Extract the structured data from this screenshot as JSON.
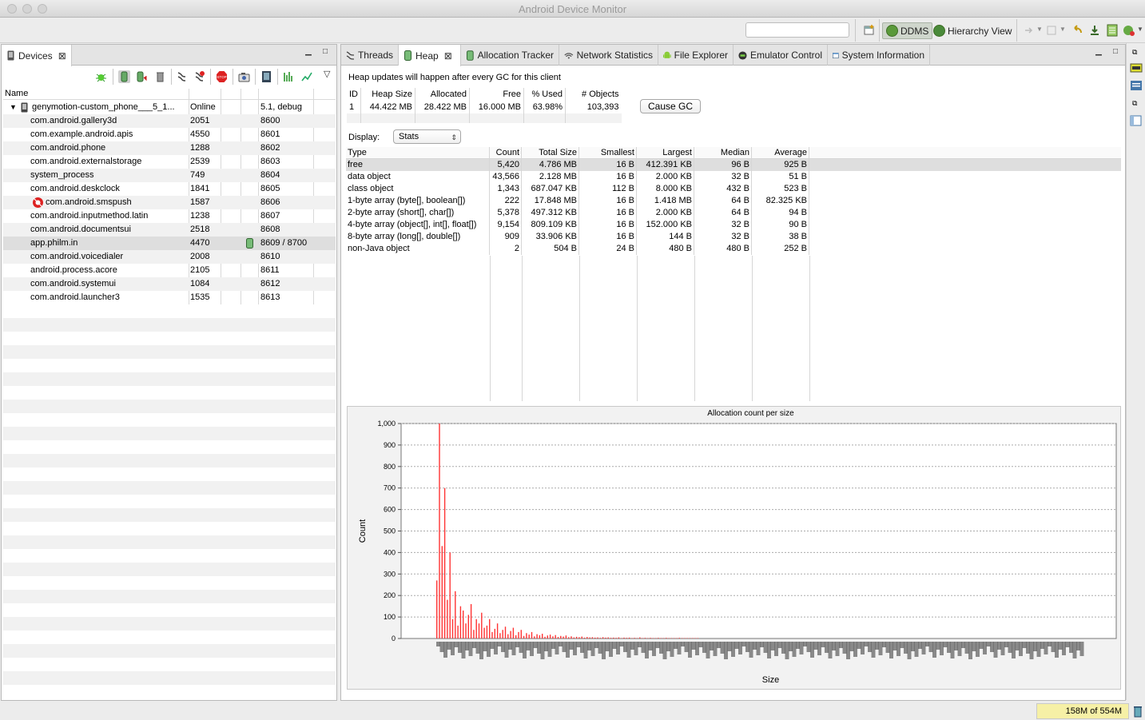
{
  "window": {
    "title": "Android Device Monitor"
  },
  "toolbar": {
    "perspectives": [
      {
        "label": "DDMS",
        "active": true
      },
      {
        "label": "Hierarchy View",
        "active": false
      }
    ]
  },
  "devices_panel": {
    "tab_label": "Devices",
    "columns": [
      "Name"
    ],
    "device": {
      "name": "genymotion-custom_phone___5_1...",
      "status": "Online",
      "version": "5.1, debug"
    },
    "processes": [
      {
        "name": "com.android.gallery3d",
        "pid": "2051",
        "port": "8600"
      },
      {
        "name": "com.example.android.apis",
        "pid": "4550",
        "port": "8601"
      },
      {
        "name": "com.android.phone",
        "pid": "1288",
        "port": "8602"
      },
      {
        "name": "com.android.externalstorage",
        "pid": "2539",
        "port": "8603"
      },
      {
        "name": "system_process",
        "pid": "749",
        "port": "8604"
      },
      {
        "name": "com.android.deskclock",
        "pid": "1841",
        "port": "8605"
      },
      {
        "name": "com.android.smspush",
        "pid": "1587",
        "port": "8606",
        "debug_icon": true
      },
      {
        "name": "com.android.inputmethod.latin",
        "pid": "1238",
        "port": "8607"
      },
      {
        "name": "com.android.documentsui",
        "pid": "2518",
        "port": "8608"
      },
      {
        "name": "app.philm.in",
        "pid": "4470",
        "port": "8609 / 8700",
        "selected": true,
        "heap_icon": true
      },
      {
        "name": "com.android.voicedialer",
        "pid": "2008",
        "port": "8610"
      },
      {
        "name": "android.process.acore",
        "pid": "2105",
        "port": "8611"
      },
      {
        "name": "com.android.systemui",
        "pid": "1084",
        "port": "8612"
      },
      {
        "name": "com.android.launcher3",
        "pid": "1535",
        "port": "8613"
      }
    ]
  },
  "tabs": [
    {
      "label": "Threads",
      "icon": "threads-icon"
    },
    {
      "label": "Heap",
      "icon": "heap-icon",
      "active": true
    },
    {
      "label": "Allocation Tracker",
      "icon": "allocation-icon"
    },
    {
      "label": "Network Statistics",
      "icon": "network-icon"
    },
    {
      "label": "File Explorer",
      "icon": "android-icon"
    },
    {
      "label": "Emulator Control",
      "icon": "emulator-icon"
    },
    {
      "label": "System Information",
      "icon": "sysinfo-icon"
    }
  ],
  "heap": {
    "message": "Heap updates will happen after every GC for this client",
    "summary_headers": [
      "ID",
      "Heap Size",
      "Allocated",
      "Free",
      "% Used",
      "# Objects"
    ],
    "summary_row": [
      "1",
      "44.422 MB",
      "28.422 MB",
      "16.000 MB",
      "63.98%",
      "103,393"
    ],
    "cause_gc_label": "Cause GC",
    "display_label": "Display:",
    "display_value": "Stats",
    "stats_headers": [
      "Type",
      "Count",
      "Total Size",
      "Smallest",
      "Largest",
      "Median",
      "Average"
    ],
    "stats_rows": [
      [
        "free",
        "5,420",
        "4.786 MB",
        "16 B",
        "412.391 KB",
        "96 B",
        "925 B"
      ],
      [
        "data object",
        "43,566",
        "2.128 MB",
        "16 B",
        "2.000 KB",
        "32 B",
        "51 B"
      ],
      [
        "class object",
        "1,343",
        "687.047 KB",
        "112 B",
        "8.000 KB",
        "432 B",
        "523 B"
      ],
      [
        "1-byte array (byte[], boolean[])",
        "222",
        "17.848 MB",
        "16 B",
        "1.418 MB",
        "64 B",
        "82.325 KB"
      ],
      [
        "2-byte array (short[], char[])",
        "5,378",
        "497.312 KB",
        "16 B",
        "2.000 KB",
        "64 B",
        "94 B"
      ],
      [
        "4-byte array (object[], int[], float[])",
        "9,154",
        "809.109 KB",
        "16 B",
        "152.000 KB",
        "32 B",
        "90 B"
      ],
      [
        "8-byte array (long[], double[])",
        "909",
        "33.906 KB",
        "16 B",
        "144 B",
        "32 B",
        "38 B"
      ],
      [
        "non-Java object",
        "2",
        "504 B",
        "24 B",
        "480 B",
        "480 B",
        "252 B"
      ]
    ]
  },
  "chart_data": {
    "type": "bar",
    "title": "Allocation count per size",
    "xlabel": "Size",
    "ylabel": "Count",
    "ylim": [
      0,
      1000
    ],
    "yticks": [
      "0",
      "100",
      "200",
      "300",
      "400",
      "500",
      "600",
      "700",
      "800",
      "900",
      "1,000"
    ],
    "grid": true,
    "color": "#ff3333",
    "values": [
      270,
      1000,
      430,
      700,
      180,
      400,
      90,
      220,
      60,
      150,
      130,
      70,
      110,
      160,
      40,
      90,
      70,
      120,
      50,
      60,
      90,
      30,
      45,
      70,
      25,
      40,
      55,
      20,
      35,
      50,
      15,
      30,
      40,
      12,
      25,
      18,
      30,
      10,
      20,
      15,
      22,
      8,
      14,
      18,
      10,
      16,
      7,
      12,
      9,
      14,
      6,
      10,
      5,
      8,
      6,
      9,
      4,
      7,
      5,
      6,
      4,
      5,
      3,
      6,
      4,
      5,
      3,
      4,
      3,
      5,
      2,
      4,
      3,
      4,
      2,
      3,
      2,
      5,
      2,
      3,
      2,
      3,
      2,
      2,
      3,
      2,
      2,
      3,
      2,
      2,
      2,
      2,
      3,
      2,
      2,
      2,
      2,
      2,
      2,
      2
    ]
  },
  "status": {
    "memory": "158M of 554M"
  }
}
